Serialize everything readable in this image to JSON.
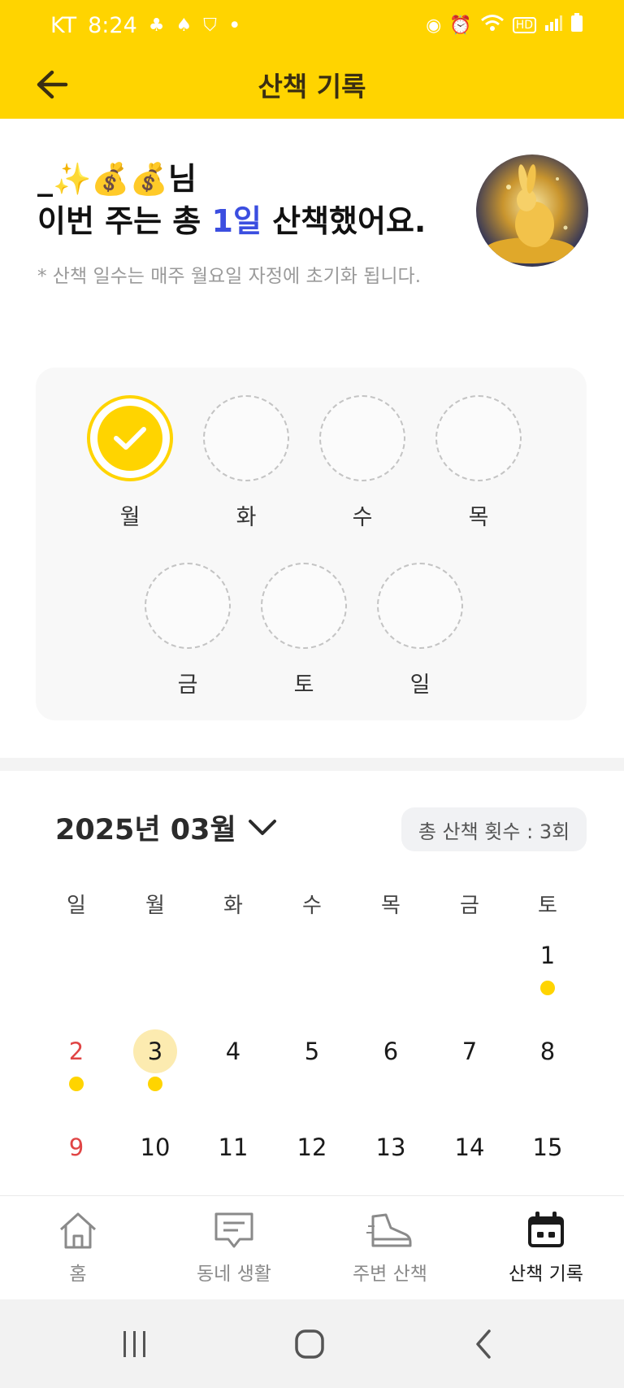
{
  "status_bar": {
    "carrier": "KT",
    "time": "8:24",
    "dot": "•",
    "hd": "HD"
  },
  "header": {
    "title": "산책 기록",
    "back_icon": "arrow-left-icon"
  },
  "greeting": {
    "name": "_✨💰💰님",
    "week_prefix": "이번 주는 총 ",
    "week_days": "1일",
    "week_suffix": " 산책했어요.",
    "note": "* 산책 일수는 매주 월요일 자정에 초기화 됩니다."
  },
  "weekly": {
    "days": [
      {
        "label": "월",
        "done": true
      },
      {
        "label": "화",
        "done": false
      },
      {
        "label": "수",
        "done": false
      },
      {
        "label": "목",
        "done": false
      },
      {
        "label": "금",
        "done": false
      },
      {
        "label": "토",
        "done": false
      },
      {
        "label": "일",
        "done": false
      }
    ]
  },
  "calendar": {
    "month_label": "2025년 03월",
    "total_walks": "총 산책 횟수 : 3회",
    "weekdays": [
      "일",
      "월",
      "화",
      "수",
      "목",
      "금",
      "토"
    ],
    "weeks": [
      [
        null,
        null,
        null,
        null,
        null,
        null,
        {
          "day": "1",
          "walked": true
        }
      ],
      [
        {
          "day": "2",
          "walked": true
        },
        {
          "day": "3",
          "walked": true,
          "today": true
        },
        {
          "day": "4"
        },
        {
          "day": "5"
        },
        {
          "day": "6"
        },
        {
          "day": "7"
        },
        {
          "day": "8"
        }
      ],
      [
        {
          "day": "9"
        },
        {
          "day": "10"
        },
        {
          "day": "11"
        },
        {
          "day": "12"
        },
        {
          "day": "13"
        },
        {
          "day": "14"
        },
        {
          "day": "15"
        }
      ]
    ]
  },
  "bottom_nav": {
    "items": [
      {
        "label": "홈",
        "icon": "home-icon",
        "active": false
      },
      {
        "label": "동네 생활",
        "icon": "chat-board-icon",
        "active": false
      },
      {
        "label": "주변 산책",
        "icon": "shoe-icon",
        "active": false
      },
      {
        "label": "산책 기록",
        "icon": "calendar-icon",
        "active": true
      }
    ]
  },
  "colors": {
    "brand_yellow": "#FFD400",
    "highlight_blue": "#3b4ee0",
    "sunday_red": "#e04545",
    "today_bg": "#fcebb0"
  }
}
